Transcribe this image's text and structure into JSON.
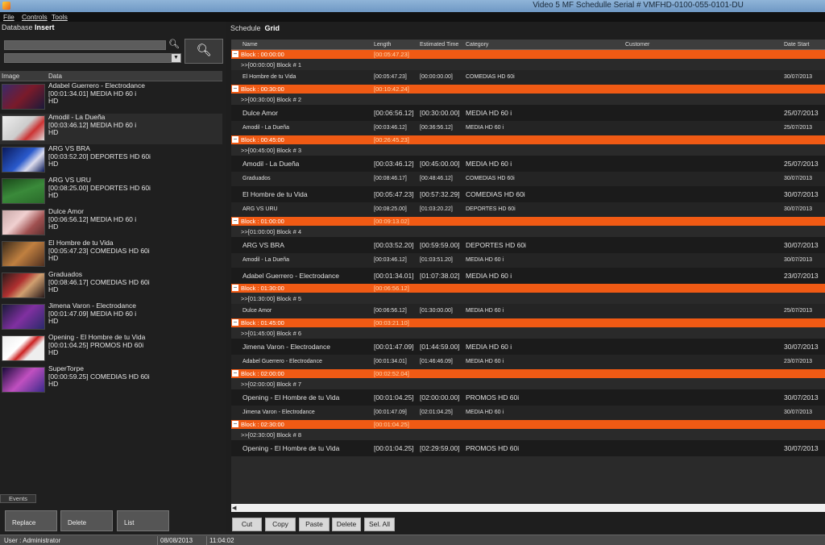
{
  "window": {
    "title": "Video 5 MF Schedulle Serial # VMFHD-0100-055-0101-DU"
  },
  "menu": {
    "file": "File",
    "controls": "Controls",
    "tools": "Tools"
  },
  "left_panel": {
    "header_prefix": "Database",
    "header_active": "Insert",
    "search_value": "",
    "filter_value": "",
    "columns": {
      "image": "Image",
      "data": "Data"
    },
    "items": [
      {
        "title": "Adabel Guerrero - Electrodance",
        "info": "[00:01:34.01]  MEDIA HD 60 i",
        "fmt": "HD"
      },
      {
        "title": "Amodil - La Dueña",
        "info": "[00:03:46.12]  MEDIA HD 60 i",
        "fmt": "HD"
      },
      {
        "title": "ARG VS BRA",
        "info": "[00:03:52.20]  DEPORTES HD 60i",
        "fmt": "HD"
      },
      {
        "title": "ARG VS URU",
        "info": "[00:08:25.00]  DEPORTES HD 60i",
        "fmt": "HD"
      },
      {
        "title": "Dulce Amor",
        "info": "[00:06:56.12]  MEDIA HD 60 i",
        "fmt": "HD"
      },
      {
        "title": "El Hombre de tu Vida",
        "info": "[00:05:47.23]  COMEDIAS HD 60i",
        "fmt": "HD"
      },
      {
        "title": "Graduados",
        "info": "[00:08:46.17]  COMEDIAS HD 60i",
        "fmt": "HD"
      },
      {
        "title": "Jimena Varon - Electrodance",
        "info": "[00:01:47.09]  MEDIA HD 60 i",
        "fmt": "HD"
      },
      {
        "title": "Opening - El Hombre de tu Vida",
        "info": "[00:01:04.25]  PROMOS HD 60i",
        "fmt": "HD"
      },
      {
        "title": "SuperTorpe",
        "info": "[00:00:59.25]  COMEDIAS HD 60i",
        "fmt": "HD"
      }
    ],
    "events_tab": "Events",
    "buttons": {
      "replace": "Replace",
      "delete": "Delete",
      "list": "List"
    }
  },
  "right_panel": {
    "header_prefix": "Schedule",
    "header_active": "Grid",
    "columns": {
      "name": "Name",
      "length": "Length",
      "estimated": "Estimated Time",
      "category": "Category",
      "customer": "Customer",
      "date_start": "Date Start"
    },
    "blocks": [
      {
        "label": "Block : 00:00:00",
        "duration": "[00:05:47.23]",
        "header": ">>[00:00:00] Block # 1",
        "rows": [
          {
            "name": "El Hombre de tu Vida",
            "length": "[00:05:47.23]",
            "est": "[00:00:00.00]",
            "cat": "COMEDIAS HD 60i",
            "date": "30/07/2013",
            "big": false
          }
        ]
      },
      {
        "label": "Block : 00:30:00",
        "duration": "[00:10:42.24]",
        "header": ">>[00:30:00] Block # 2",
        "rows": [
          {
            "name": "Dulce Amor",
            "length": "[00:06:56.12]",
            "est": "[00:30:00.00]",
            "cat": "MEDIA HD 60 i",
            "date": "25/07/2013",
            "big": true
          },
          {
            "name": "Amodil - La Dueña",
            "length": "[00:03:46.12]",
            "est": "[00:36:56.12]",
            "cat": "MEDIA HD 60 i",
            "date": "25/07/2013",
            "big": false
          }
        ]
      },
      {
        "label": "Block : 00:45:00",
        "duration": "[00:26:45.23]",
        "header": ">>[00:45:00] Block # 3",
        "rows": [
          {
            "name": "Amodil - La Dueña",
            "length": "[00:03:46.12]",
            "est": "[00:45:00.00]",
            "cat": "MEDIA HD 60 i",
            "date": "25/07/2013",
            "big": true
          },
          {
            "name": "Graduados",
            "length": "[00:08:46.17]",
            "est": "[00:48:46.12]",
            "cat": "COMEDIAS HD 60i",
            "date": "30/07/2013",
            "big": false
          },
          {
            "name": "El Hombre de tu Vida",
            "length": "[00:05:47.23]",
            "est": "[00:57:32.29]",
            "cat": "COMEDIAS HD 60i",
            "date": "30/07/2013",
            "big": true
          },
          {
            "name": "ARG VS URU",
            "length": "[00:08:25.00]",
            "est": "[01:03:20.22]",
            "cat": "DEPORTES HD 60i",
            "date": "30/07/2013",
            "big": false
          }
        ]
      },
      {
        "label": "Block : 01:00:00",
        "duration": "[00:09:13.02]",
        "header": ">>[01:00:00] Block # 4",
        "rows": [
          {
            "name": "ARG VS BRA",
            "length": "[00:03:52.20]",
            "est": "[00:59:59.00]",
            "cat": "DEPORTES HD 60i",
            "date": "30/07/2013",
            "big": true
          },
          {
            "name": "Amodil - La Dueña",
            "length": "[00:03:46.12]",
            "est": "[01:03:51.20]",
            "cat": "MEDIA HD 60 i",
            "date": "30/07/2013",
            "big": false
          },
          {
            "name": "Adabel Guerrero - Electrodance",
            "length": "[00:01:34.01]",
            "est": "[01:07:38.02]",
            "cat": "MEDIA HD 60 i",
            "date": "23/07/2013",
            "big": true
          }
        ]
      },
      {
        "label": "Block : 01:30:00",
        "duration": "[00:06:56.12]",
        "header": ">>[01:30:00] Block # 5",
        "rows": [
          {
            "name": "Dulce Amor",
            "length": "[00:06:56.12]",
            "est": "[01:30:00.00]",
            "cat": "MEDIA HD 60 i",
            "date": "25/07/2013",
            "big": false
          }
        ]
      },
      {
        "label": "Block : 01:45:00",
        "duration": "[00:03:21.10]",
        "header": ">>[01:45:00] Block # 6",
        "rows": [
          {
            "name": "Jimena Varon - Electrodance",
            "length": "[00:01:47.09]",
            "est": "[01:44:59.00]",
            "cat": "MEDIA HD 60 i",
            "date": "30/07/2013",
            "big": true
          },
          {
            "name": "Adabel Guerrero - Electrodance",
            "length": "[00:01:34.01]",
            "est": "[01:46:46.09]",
            "cat": "MEDIA HD 60 i",
            "date": "23/07/2013",
            "big": false
          }
        ]
      },
      {
        "label": "Block : 02:00:00",
        "duration": "[00:02:52.04]",
        "header": ">>[02:00:00] Block # 7",
        "rows": [
          {
            "name": "Opening - El Hombre de tu Vida",
            "length": "[00:01:04.25]",
            "est": "[02:00:00.00]",
            "cat": "PROMOS HD 60i",
            "date": "30/07/2013",
            "big": true
          },
          {
            "name": "Jimena Varon - Electrodance",
            "length": "[00:01:47.09]",
            "est": "[02:01:04.25]",
            "cat": "MEDIA HD 60 i",
            "date": "30/07/2013",
            "big": false
          }
        ]
      },
      {
        "label": "Block : 02:30:00",
        "duration": "[00:01:04.25]",
        "header": ">>[02:30:00] Block # 8",
        "rows": [
          {
            "name": "Opening - El Hombre de tu Vida",
            "length": "[00:01:04.25]",
            "est": "[02:29:59.00]",
            "cat": "PROMOS HD 60i",
            "date": "30/07/2013",
            "big": true
          }
        ]
      }
    ],
    "buttons": {
      "cut": "Cut",
      "copy": "Copy",
      "paste": "Paste",
      "delete": "Delete",
      "sel_all": "Sel. All"
    }
  },
  "status": {
    "user": "User : Administrator",
    "date": "08/08/2013",
    "time": "11:04:02"
  },
  "colors": {
    "block_bar": "#f05a14",
    "background": "#1e1e1e"
  }
}
